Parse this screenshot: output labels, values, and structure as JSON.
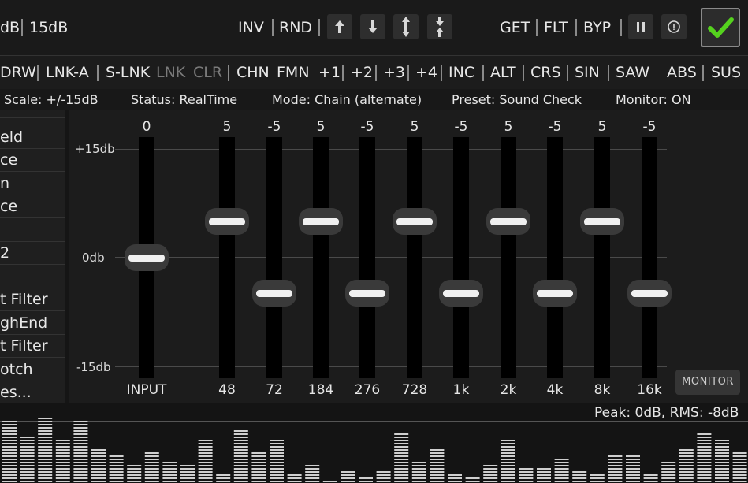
{
  "toolbar": {
    "db_left": "dB",
    "db_15": "15dB",
    "inv": "INV",
    "rnd": "RND",
    "get": "GET",
    "flt": "FLT",
    "byp": "BYP",
    "icons": [
      "arrow-up-icon",
      "arrow-down-icon",
      "expand-vertical-icon",
      "compress-vertical-icon",
      "pause-icon",
      "info-icon",
      "checkmark-icon"
    ],
    "accent": "#55d21e"
  },
  "functions": [
    "DRW",
    "LNK-A",
    "S-LNK",
    "LNK",
    "CLR",
    "CHN",
    "FMN",
    "+1",
    "+2",
    "+3",
    "+4",
    "INC",
    "ALT",
    "CRS",
    "SIN",
    "SAW",
    "ABS",
    "SUS"
  ],
  "status": {
    "scale": "Scale: +/-15dB",
    "status": "Status: RealTime",
    "mode": "Mode: Chain (alternate)",
    "preset": "Preset: Sound Check",
    "monitor": "Monitor: ON"
  },
  "presets": [
    "",
    "eld",
    "ce",
    "n",
    "ce",
    "",
    "2",
    "",
    "t Filter",
    "ghEnd",
    "t Filter",
    "otch",
    "es..."
  ],
  "eq": {
    "axis": {
      "top": "+15db",
      "mid": "0db",
      "bottom": "-15db"
    },
    "range": [
      -15,
      15
    ],
    "bands": [
      {
        "label": "INPUT",
        "value": 0,
        "value_label": "0"
      },
      {
        "label": "48",
        "value": 5,
        "value_label": "5"
      },
      {
        "label": "72",
        "value": -5,
        "value_label": "-5"
      },
      {
        "label": "184",
        "value": 5,
        "value_label": "5"
      },
      {
        "label": "276",
        "value": -5,
        "value_label": "-5"
      },
      {
        "label": "728",
        "value": 5,
        "value_label": "5"
      },
      {
        "label": "1k",
        "value": -5,
        "value_label": "-5"
      },
      {
        "label": "2k",
        "value": 5,
        "value_label": "5"
      },
      {
        "label": "4k",
        "value": -5,
        "value_label": "-5"
      },
      {
        "label": "8k",
        "value": 5,
        "value_label": "5"
      },
      {
        "label": "16k",
        "value": -5,
        "value_label": "-5"
      }
    ],
    "monitor_button": "MONITOR"
  },
  "analyzer": {
    "peak": "Peak: 0dB, RMS: -8dB",
    "levels": [
      0.82,
      0.62,
      0.86,
      0.58,
      0.82,
      0.46,
      0.36,
      0.26,
      0.4,
      0.28,
      0.26,
      0.58,
      0.14,
      0.68,
      0.4,
      0.58,
      0.14,
      0.26,
      0.06,
      0.16,
      0.08,
      0.16,
      0.66,
      0.3,
      0.46,
      0.12,
      0.08,
      0.24,
      0.58,
      0.22,
      0.2,
      0.34,
      0.16,
      0.12,
      0.36,
      0.36,
      0.12,
      0.28,
      0.46,
      0.64,
      0.56,
      0.4
    ]
  }
}
